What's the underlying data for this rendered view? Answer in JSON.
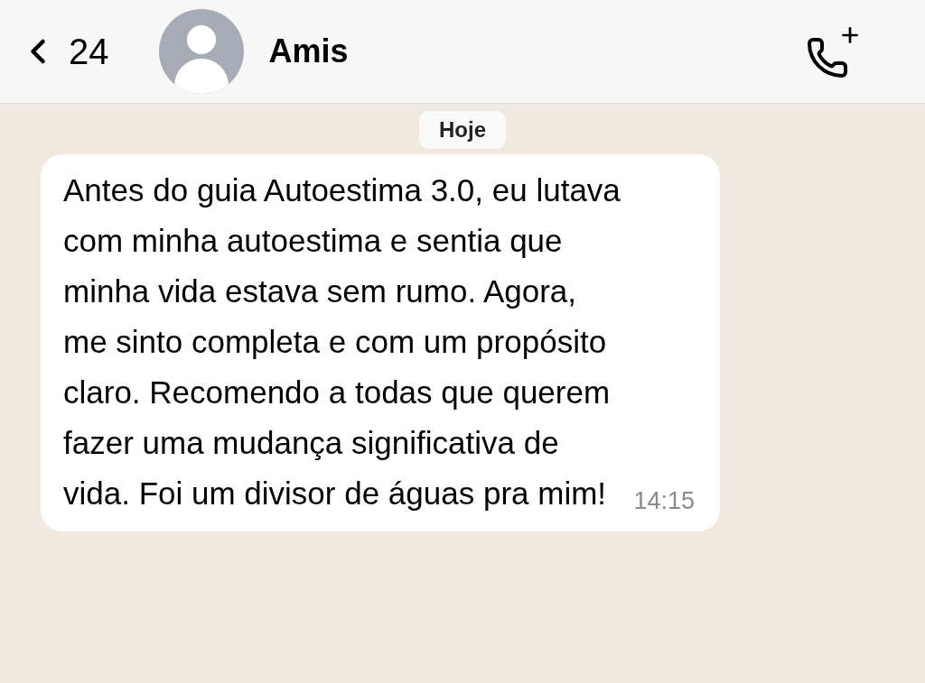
{
  "header": {
    "back_count": "24",
    "contact_name": "Amis"
  },
  "date_chip": "Hoje",
  "messages": [
    {
      "text": "Antes do guia Autoestima 3.0, eu lutava com minha autoestima e sentia que minha vida estava sem rumo. Agora, me sinto completa e com um propósito claro. Recomendo a todas que querem fazer uma mudança significativa de vida. Foi um divisor de águas pra mim!",
      "time": "14:15"
    }
  ]
}
